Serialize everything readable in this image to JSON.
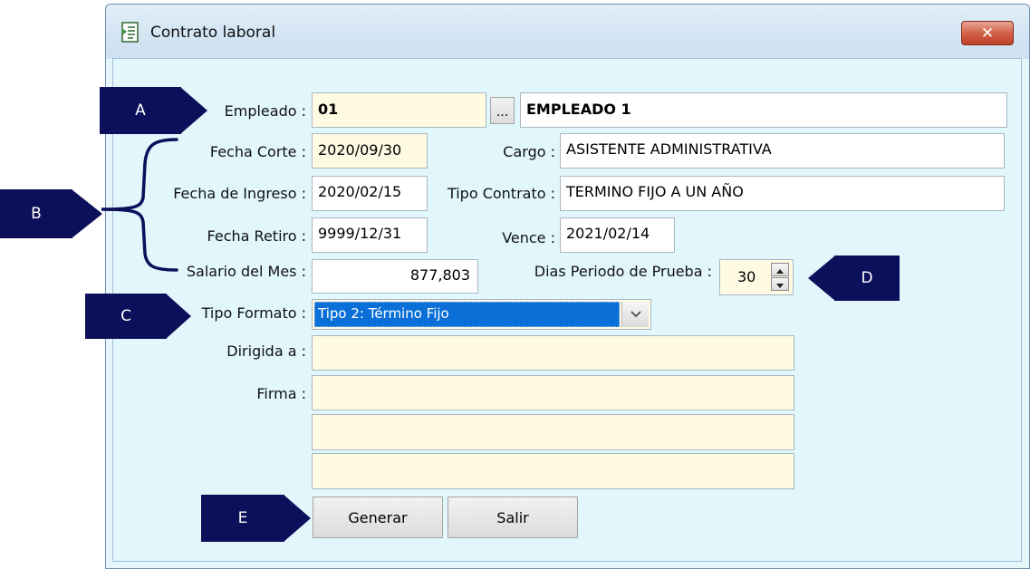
{
  "window": {
    "title": "Contrato laboral",
    "close_label": "✕"
  },
  "form": {
    "empleado_label": "Empleado :",
    "empleado_code": "01",
    "browse_label": "...",
    "empleado_name": "EMPLEADO 1",
    "fecha_corte_label": "Fecha Corte :",
    "fecha_corte": "2020/09/30",
    "cargo_label": "Cargo :",
    "cargo": "ASISTENTE ADMINISTRATIVA",
    "fecha_ingreso_label": "Fecha de Ingreso :",
    "fecha_ingreso": "2020/02/15",
    "tipo_contrato_label": "Tipo Contrato :",
    "tipo_contrato": "TERMINO FIJO A UN AÑO",
    "fecha_retiro_label": "Fecha Retiro :",
    "fecha_retiro": "9999/12/31",
    "vence_label": "Vence :",
    "vence": "2021/02/14",
    "salario_label": "Salario del Mes :",
    "salario": "877,803",
    "dias_prueba_label": "Dias Periodo de Prueba :",
    "dias_prueba": "30",
    "tipo_formato_label": "Tipo Formato :",
    "tipo_formato": "Tipo 2: Término Fijo",
    "dirigida_label": "Dirigida a :",
    "dirigida": "",
    "firma_label": "Firma :",
    "firma_1": "",
    "firma_2": "",
    "firma_3": ""
  },
  "buttons": {
    "generar": "Generar",
    "salir": "Salir"
  },
  "callouts": {
    "a": "A",
    "b": "B",
    "c": "C",
    "d": "D",
    "e": "E"
  },
  "colors": {
    "callout": "#0c0f59",
    "selection": "#0a6fd6",
    "field_yellow": "#fffbe3",
    "client_bg": "#e1f7fc"
  },
  "icons": {
    "title": "form-document-icon",
    "close": "close-icon",
    "dropdown": "chevron-down-icon",
    "spin_up": "spin-up-arrow-icon",
    "spin_down": "spin-down-arrow-icon"
  }
}
